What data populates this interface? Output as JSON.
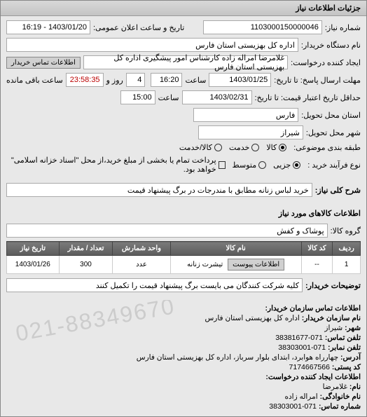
{
  "panel_title": "جزئیات اطلاعات نیاز",
  "need_number_label": "شماره نیاز:",
  "need_number": "1103000150000046",
  "announce_label": "تاریخ و ساعت اعلان عمومی:",
  "announce_value": "1403/01/20 - 16:19",
  "buyer_org_label": "نام دستگاه خریدار:",
  "buyer_org": "اداره کل بهزیستی استان فارس",
  "requester_label": "ایجاد کننده درخواست:",
  "requester": "غلامرضا امراله زاده کارشناس امور پیشگیری اداره کل بهزیستی استان فارس",
  "buyer_contact_btn": "اطلاعات تماس خریدار",
  "deadline_reply_label": "مهلت ارسال پاسخ: تا تاریخ:",
  "deadline_reply_date": "1403/01/25",
  "deadline_reply_time_label": "ساعت",
  "deadline_reply_time": "16:20",
  "remaining_days": "4",
  "remaining_days_label": "روز و",
  "remaining_time": "23:58:35",
  "remaining_time_label": "ساعت باقی مانده",
  "price_validity_label": "حداقل تاریخ اعتبار قیمت: تا تاریخ:",
  "price_validity_date": "1403/02/31",
  "price_validity_time": "15:00",
  "price_validity_time_label": "ساعت",
  "delivery_province_label": "استان محل تحویل:",
  "delivery_province": "فارس",
  "delivery_city_label": "شهر محل تحویل:",
  "delivery_city": "شیراز",
  "subject_category_label": "طبقه بندی موضوعی:",
  "radio_goods": "کالا",
  "radio_service": "خدمت",
  "radio_goods_service": "کالا/خدمت",
  "purchase_type_label": "نوع فرآیند خرید :",
  "radio_minor": "جزیی",
  "radio_medium": "متوسط",
  "purchase_note": "پرداخت تمام یا بخشی از مبلغ خرید،از محل \"اسناد خزانه اسلامی\" خواهد بود.",
  "need_title_label": "شرح کلی نیاز:",
  "need_title": "خرید لباس زنانه مطابق با مندرجات در برگ پیشنهاد قیمت",
  "goods_info_title": "اطلاعات كالاهای مورد نیاز",
  "goods_group_label": "گروه کالا:",
  "goods_group": "پوشاک و کفش",
  "table": {
    "headers": [
      "ردیف",
      "کد کالا",
      "نام کالا",
      "واحد شمارش",
      "تعداد / مقدار",
      "تاریخ نیاز"
    ],
    "row1": [
      "1",
      "--",
      "تیشرت زنانه",
      "عدد",
      "300",
      "1403/01/26"
    ]
  },
  "attachment_label": "اطلاعات پیوست",
  "buyer_notes_label": "توضیحات خریدار:",
  "buyer_notes": "کلیه شرکت کنندگان می بایست برگ پیشنهاد قیمت را تکمیل کنند",
  "contact_title": "اطلاعات تماس سازمان خریدار:",
  "contact": {
    "org_label": "نام سازمان خریدار:",
    "org": "اداره کل بهزیستی استان فارس",
    "city_label": "شهر:",
    "city": "شیراز",
    "phone_label": "تلفن تماس:",
    "phone": "071-38381677",
    "fax_label": "تلفن نمابر:",
    "fax": "071-38303001",
    "address_label": "آدرس:",
    "address": "چهارراه هوابرد، ابتدای بلوار سرباز، اداره کل بهزیستی استان فارس",
    "postal_label": "کد پستی:",
    "postal": "7174667566"
  },
  "creator_title": "اطلاعات ایجاد کننده درخواست:",
  "creator": {
    "name_label": "نام:",
    "name": "غلامرضا",
    "family_label": "نام خانوادگی:",
    "family": "امراله زاده",
    "phone_label": "شماره تماس:",
    "phone": "071-38303001"
  },
  "watermark": "021-88349670"
}
